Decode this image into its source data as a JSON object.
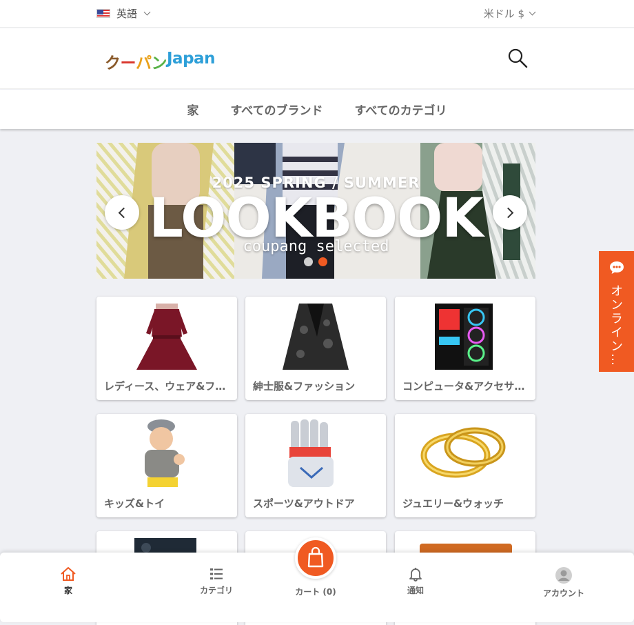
{
  "topbar": {
    "language": "英語",
    "currency": "米ドル $"
  },
  "header": {
    "logo_parts": [
      "ク",
      "ー",
      "パ",
      "ン",
      "Japan"
    ]
  },
  "nav": {
    "items": [
      "家",
      "すべてのブランド",
      "すべてのカテゴリ"
    ]
  },
  "banner": {
    "subtitle": "2025 SPRING / SUMMER",
    "title": "LOOKBOOK",
    "tagline": "coupang selected",
    "slides": 2,
    "active_slide": 2
  },
  "categories": [
    {
      "label": "レディース、ウェア&ファッション",
      "image": "red-lace-dress"
    },
    {
      "label": "紳士服&ファッション",
      "image": "black-paisley-blazer"
    },
    {
      "label": "コンピュータ&アクセサリー",
      "image": "gaming-pc-tower"
    },
    {
      "label": "キッズ&トイ",
      "image": "baby-with-hat"
    },
    {
      "label": "スポーツ&アウトドア",
      "image": "cricket-gloves"
    },
    {
      "label": "ジュエリー&ウォッチ",
      "image": "gold-rings"
    }
  ],
  "chat": {
    "label": "オンライン…"
  },
  "bottombar": {
    "home": "家",
    "category": "カテゴリ",
    "cart": "カート (0)",
    "notifications": "通知",
    "account": "アカウント"
  },
  "colors": {
    "accent": "#f05a22",
    "background": "#eff0f4"
  }
}
